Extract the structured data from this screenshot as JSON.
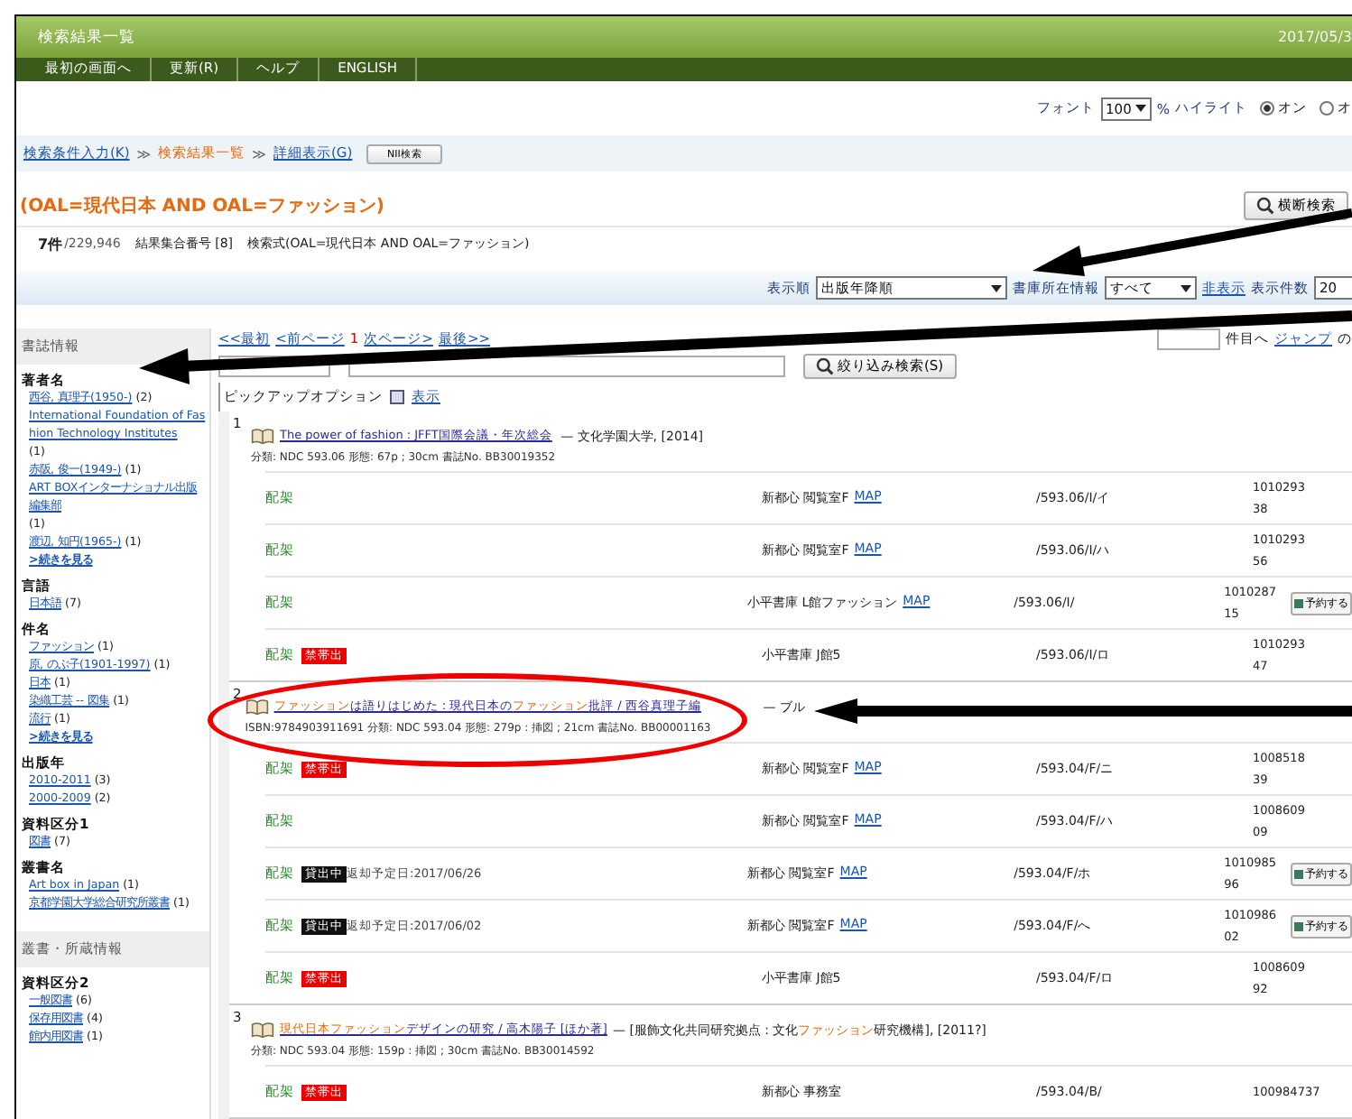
{
  "header": {
    "title": "検索結果一覧",
    "date": "2017/05/3",
    "menu": [
      "最初の画面へ",
      "更新(R)",
      "ヘルプ",
      "ENGLISH"
    ]
  },
  "font_row": {
    "label": "フォント",
    "value": "100",
    "unit": "%",
    "highlight_label": "ハイライト",
    "options": [
      {
        "label": "オン",
        "selected": true
      },
      {
        "label": "オ",
        "selected": false
      }
    ]
  },
  "breadcrumb": {
    "items": [
      {
        "label": "検索条件入力(K)",
        "kind": "link"
      },
      {
        "label": "検索結果一覧",
        "kind": "current",
        "separator": "≫"
      },
      {
        "label": "詳細表示(G)",
        "kind": "link",
        "separator": "≫"
      }
    ],
    "button": "NII検索"
  },
  "query_title": "(OAL=現代日本 AND OAL=ファッション)",
  "cross_search_button": "横断検索",
  "summary": {
    "count": "7件",
    "total": "/229,946",
    "set": "結果集合番号 [8]",
    "expression": "検索式(OAL=現代日本 AND OAL=ファッション)"
  },
  "sort_bar": {
    "sort_label": "表示順",
    "sort_value": "出版年降順",
    "holdings_label": "書庫所在情報",
    "holdings_value": "すべて",
    "hide_link": "非表示",
    "per_page_label": "表示件数",
    "per_page": "20"
  },
  "pager": {
    "links": [
      {
        "label": "<<最初",
        "kind": "link"
      },
      {
        "label": "<前ページ",
        "kind": "link"
      },
      {
        "label": "1",
        "kind": "current"
      },
      {
        "label": "次ページ>",
        "kind": "link"
      },
      {
        "label": "最後>>",
        "kind": "link"
      }
    ],
    "jump_suffix": "件目へ",
    "jump_link": "ジャンプ",
    "tail": "の"
  },
  "refine_button": "絞り込み検索(S)",
  "pickup": {
    "label": "ピックアップオプション",
    "link": "表示"
  },
  "sidebar": [
    {
      "title": "書誌情報",
      "groups": [
        {
          "heading": "著者名",
          "items": [
            {
              "label": "西谷, 真理子(1950-)",
              "count": "(2)"
            },
            {
              "label": "International Foundation of Fashion Technology Institutes",
              "count": "(1)"
            },
            {
              "label": "赤阪, 俊一(1949-)",
              "count": "(1)"
            },
            {
              "label": "ART BOXインターナショナル出版編集部",
              "count": "(1)"
            },
            {
              "label": "渡辺, 知円(1965-)",
              "count": "(1)"
            }
          ],
          "more": ">続きを見る"
        },
        {
          "heading": "言語",
          "items": [
            {
              "label": "日本語",
              "count": "(7)"
            }
          ]
        },
        {
          "heading": "件名",
          "items": [
            {
              "label": "ファッション",
              "count": "(1)"
            },
            {
              "label": "原, のぶ子(1901-1997)",
              "count": "(1)"
            },
            {
              "label": "日本",
              "count": "(1)"
            },
            {
              "label": "染織工芸 -- 図集",
              "count": "(1)"
            },
            {
              "label": "流行",
              "count": "(1)"
            }
          ],
          "more": ">続きを見る"
        },
        {
          "heading": "出版年",
          "items": [
            {
              "label": "2010-2011",
              "count": "(3)"
            },
            {
              "label": "2000-2009",
              "count": "(2)"
            }
          ]
        },
        {
          "heading": "資料区分1",
          "items": [
            {
              "label": "図書",
              "count": "(7)"
            }
          ]
        },
        {
          "heading": "叢書名",
          "items": [
            {
              "label": "Art box in Japan",
              "count": "(1)"
            },
            {
              "label": "京都学園大学総合研究所叢書",
              "count": "(1)"
            }
          ]
        }
      ]
    },
    {
      "title": "叢書・所蔵情報",
      "groups": [
        {
          "heading": "資料区分2",
          "items": [
            {
              "label": "一般図書",
              "count": "(6)"
            },
            {
              "label": "保存用図書",
              "count": "(4)"
            },
            {
              "label": "館内用図書",
              "count": "(1)"
            }
          ]
        }
      ]
    }
  ],
  "results": [
    {
      "number": "1",
      "title": [
        {
          "text": "The power of fashion : JFFT国際会議・年次総会",
          "highlight": false
        }
      ],
      "rest": [
        {
          "text": "— 文化学園大学, [2014]",
          "highlight": false
        }
      ],
      "detail": "分類: NDC 593.06  形態: 67p ; 30cm  書誌No. BB30019352",
      "circled": false,
      "holdings": [
        {
          "status": "配架",
          "location": "新都心 閲覧室F",
          "map": "MAP",
          "call_no": "/593.06/I/イ",
          "barcode": [
            "1010293",
            "38"
          ]
        },
        {
          "status": "配架",
          "location": "新都心 閲覧室F",
          "map": "MAP",
          "call_no": "/593.06/I/ハ",
          "barcode": [
            "1010293",
            "56"
          ]
        },
        {
          "status": "配架",
          "location": "小平書庫 L館ファッション",
          "map": "MAP",
          "call_no": "/593.06/I/",
          "barcode": [
            "1010287",
            "15"
          ],
          "reserve": "予約する"
        },
        {
          "status": "配架",
          "badge": {
            "kind": "restricted",
            "text": "禁帯出"
          },
          "location": "小平書庫 J館5",
          "call_no": "/593.06/I/ロ",
          "barcode": [
            "1010293",
            "47"
          ]
        }
      ]
    },
    {
      "number": "2",
      "title": [
        {
          "text": "ファッション",
          "highlight": true
        },
        {
          "text": "は語りはじめた : 現代日本の",
          "highlight": false
        },
        {
          "text": "ファッション",
          "highlight": true
        },
        {
          "text": "批評 / 西谷真理子編",
          "highlight": false
        }
      ],
      "rest": [
        {
          "text": "— ブル",
          "highlight": false
        }
      ],
      "detail": "ISBN:9784903911691  分類: NDC 593.04  形態: 279p : 挿図 ; 21cm  書誌No. BB00001163",
      "circled": true,
      "holdings": [
        {
          "status": "配架",
          "badge": {
            "kind": "restricted",
            "text": "禁帯出"
          },
          "location": "新都心 閲覧室F",
          "map": "MAP",
          "call_no": "/593.04/F/ニ",
          "barcode": [
            "1008518",
            "39"
          ]
        },
        {
          "status": "配架",
          "location": "新都心 閲覧室F",
          "map": "MAP",
          "call_no": "/593.04/F/ハ",
          "barcode": [
            "1008609",
            "09"
          ]
        },
        {
          "status": "配架",
          "badge": {
            "kind": "loaned",
            "text": "貸出中"
          },
          "note": "返却予定日:2017/06/26",
          "location": "新都心 閲覧室F",
          "map": "MAP",
          "call_no": "/593.04/F/ホ",
          "barcode": [
            "1010985",
            "96"
          ],
          "reserve": "予約する"
        },
        {
          "status": "配架",
          "badge": {
            "kind": "loaned",
            "text": "貸出中"
          },
          "note": "返却予定日:2017/06/02",
          "location": "新都心 閲覧室F",
          "map": "MAP",
          "call_no": "/593.04/F/へ",
          "barcode": [
            "1010986",
            "02"
          ],
          "reserve": "予約する"
        },
        {
          "status": "配架",
          "badge": {
            "kind": "restricted",
            "text": "禁帯出"
          },
          "location": "小平書庫 J館5",
          "call_no": "/593.04/F/ロ",
          "barcode": [
            "1008609",
            "92"
          ]
        }
      ]
    },
    {
      "number": "3",
      "title": [
        {
          "text": "現代日本",
          "highlight": true
        },
        {
          "text": "ファッション",
          "highlight": true
        },
        {
          "text": "デザインの研究 / 高木陽子 [ほか著]",
          "highlight": false
        }
      ],
      "rest": [
        {
          "text": "— [服飾文化共同研究拠点 : 文化",
          "highlight": false
        },
        {
          "text": "ファッション",
          "highlight": true
        },
        {
          "text": "研究機構], [2011?]",
          "highlight": false
        }
      ],
      "detail": "分類: NDC 593.04  形態: 159p : 挿図 ; 30cm  書誌No. BB30014592",
      "circled": false,
      "holdings": [
        {
          "status": "配架",
          "badge": {
            "kind": "restricted",
            "text": "禁帯出"
          },
          "location": "新都心 事務室",
          "call_no": "/593.04/B/",
          "barcode": [
            "100984737"
          ]
        }
      ]
    }
  ]
}
